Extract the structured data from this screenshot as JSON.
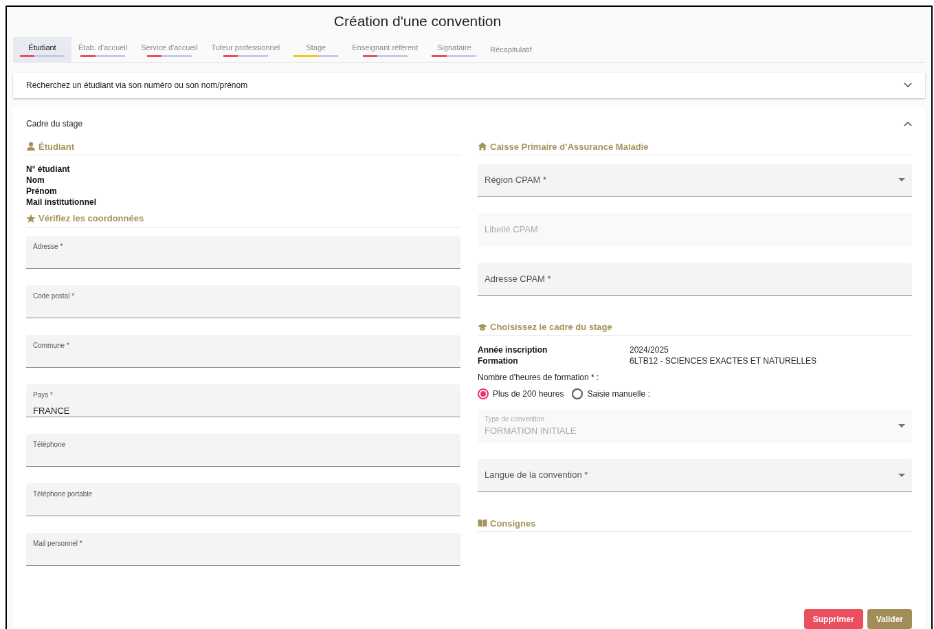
{
  "title": "Création d'une convention",
  "tabs": [
    {
      "label": "Étudiant",
      "selected": true,
      "color": "#e94f5f",
      "level": 0.33
    },
    {
      "label": "Étab. d'accueil",
      "selected": false,
      "color": "#e94f5f",
      "level": 0.33
    },
    {
      "label": "Service d'accueil",
      "selected": false,
      "color": "#e94f5f",
      "level": 0.33
    },
    {
      "label": "Tuteur professionnel",
      "selected": false,
      "color": "#e94f5f",
      "level": 0.33
    },
    {
      "label": "Stage",
      "selected": false,
      "color": "#f5c518",
      "level": 0.55
    },
    {
      "label": "Enseignant référent",
      "selected": false,
      "color": "#e94f5f",
      "level": 0.33
    },
    {
      "label": "Signataire",
      "selected": false,
      "color": "#e94f5f",
      "level": 0.33
    },
    {
      "label": "Récapitulatif",
      "selected": false
    }
  ],
  "search_panel": {
    "title": "Recherchez un étudiant via son numéro ou son nom/prénom",
    "expanded": false
  },
  "cadre_panel": {
    "title": "Cadre du stage",
    "expanded": true
  },
  "etudiant": {
    "heading": "Étudiant",
    "labels": [
      "N° étudiant",
      "Nom",
      "Prénom",
      "Mail institutionnel"
    ]
  },
  "coordonnees": {
    "heading": "Vérifiez les coordonnées",
    "fields": [
      {
        "label": "Adresse *"
      },
      {
        "label": "Code postal *"
      },
      {
        "label": "Commune *"
      },
      {
        "label": "Pays *",
        "value": "FRANCE"
      },
      {
        "label": "Téléphone"
      },
      {
        "label": "Téléphone portable"
      },
      {
        "label": "Mail personnel *"
      }
    ]
  },
  "cpam": {
    "heading": "Caisse Primaire d’Assurance Maladie",
    "fields": [
      {
        "kind": "select",
        "label": "Région CPAM *",
        "disabled": false
      },
      {
        "kind": "input",
        "label": "Libellé CPAM",
        "disabled": true
      },
      {
        "kind": "input",
        "label": "Adresse CPAM *",
        "disabled": false
      }
    ]
  },
  "cadre": {
    "heading": "Choisissez le cadre du stage",
    "info": [
      {
        "label": "Année inscription",
        "value": "2024/2025"
      },
      {
        "label": "Formation",
        "value": "6LTB12 - SCIENCES EXACTES ET NATURELLES"
      }
    ],
    "hours_label": "Nombre d'heures de formation * :",
    "hours_options": [
      {
        "label": "Plus de 200 heures",
        "selected": true
      },
      {
        "label": "Saisie manuelle :",
        "selected": false
      }
    ],
    "fields": [
      {
        "kind": "select",
        "label": "Type de convention",
        "value": "FORMATION INITIALE",
        "disabled": true
      },
      {
        "kind": "select",
        "label": "Langue de la convention *",
        "disabled": false
      }
    ]
  },
  "consignes": {
    "heading": "Consignes"
  },
  "buttons": [
    {
      "kind": "danger",
      "label": "Supprimer"
    },
    {
      "kind": "primary",
      "label": "Valider"
    }
  ]
}
